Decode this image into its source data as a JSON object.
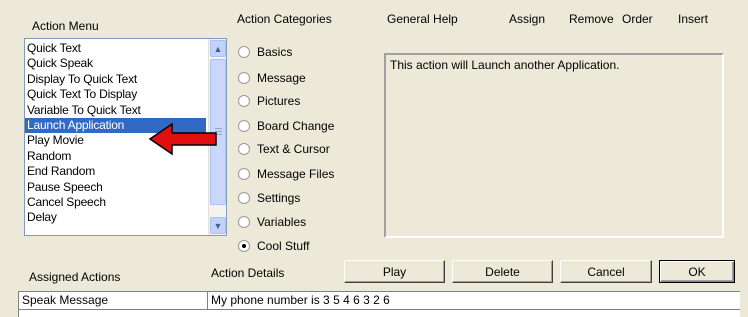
{
  "headers": {
    "action_menu": "Action Menu",
    "action_categories": "Action Categories",
    "general_help": "General Help",
    "assign": "Assign",
    "remove": "Remove",
    "order": "Order",
    "insert": "Insert",
    "assigned_actions": "Assigned Actions",
    "action_details": "Action Details"
  },
  "action_menu": {
    "items": [
      "Quick Text",
      "Quick Speak",
      "Display To Quick Text",
      "Quick Text To Display",
      "Variable To Quick Text",
      "Launch Application",
      "Play Movie",
      "Random",
      "End Random",
      "Pause Speech",
      "Cancel Speech",
      "Delay"
    ],
    "selected": "Launch Application"
  },
  "categories": {
    "items": [
      "Basics",
      "Message",
      "Pictures",
      "Board Change",
      "Text & Cursor",
      "Message Files",
      "Settings",
      "Variables",
      "Cool Stuff"
    ],
    "selected": "Cool Stuff"
  },
  "help_text": "This action will Launch another Application.",
  "buttons": {
    "play": "Play",
    "delete": "Delete",
    "cancel": "Cancel",
    "ok": "OK"
  },
  "assigned_table": {
    "rows": [
      {
        "action": "Speak Message",
        "details": "My phone number is 3 5 4 6 3 2 6"
      }
    ]
  },
  "colors": {
    "window_bg": "#ece9d8",
    "selection": "#316ac5",
    "arrow": "#e01010"
  }
}
